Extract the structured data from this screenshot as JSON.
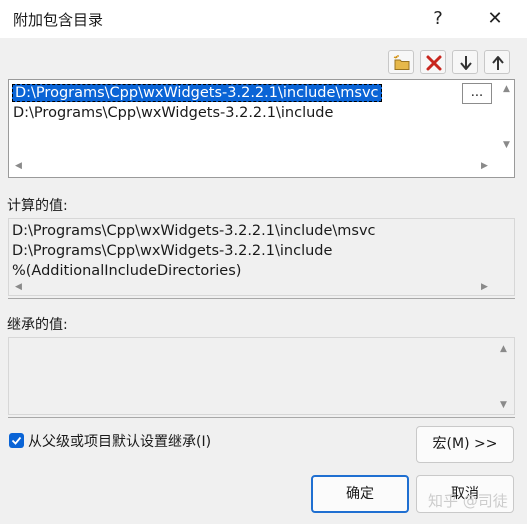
{
  "window": {
    "title": "附加包含目录",
    "help_label": "?",
    "close_label": "✕"
  },
  "toolbar": {
    "icons": [
      "new-folder-icon",
      "delete-icon",
      "move-down-icon",
      "move-up-icon"
    ]
  },
  "list": {
    "rows": [
      "D:\\Programs\\Cpp\\wxWidgets-3.2.2.1\\include\\msvc",
      "D:\\Programs\\Cpp\\wxWidgets-3.2.2.1\\include"
    ],
    "ellipsis_label": "...",
    "selected_index": 0
  },
  "computed": {
    "label": "计算的值:",
    "lines": [
      "D:\\Programs\\Cpp\\wxWidgets-3.2.2.1\\include\\msvc",
      "D:\\Programs\\Cpp\\wxWidgets-3.2.2.1\\include",
      "%(AdditionalIncludeDirectories)"
    ]
  },
  "inherited": {
    "label": "继承的值:",
    "lines": []
  },
  "inherit_checkbox": {
    "label": "从父级或项目默认设置继承(I)",
    "checked": true
  },
  "buttons": {
    "macro": "宏(M) >>",
    "ok": "确定",
    "cancel": "取消"
  },
  "watermark": "知乎 @司徒",
  "colors": {
    "accent": "#0a64d6",
    "background": "#f0f0f0"
  }
}
